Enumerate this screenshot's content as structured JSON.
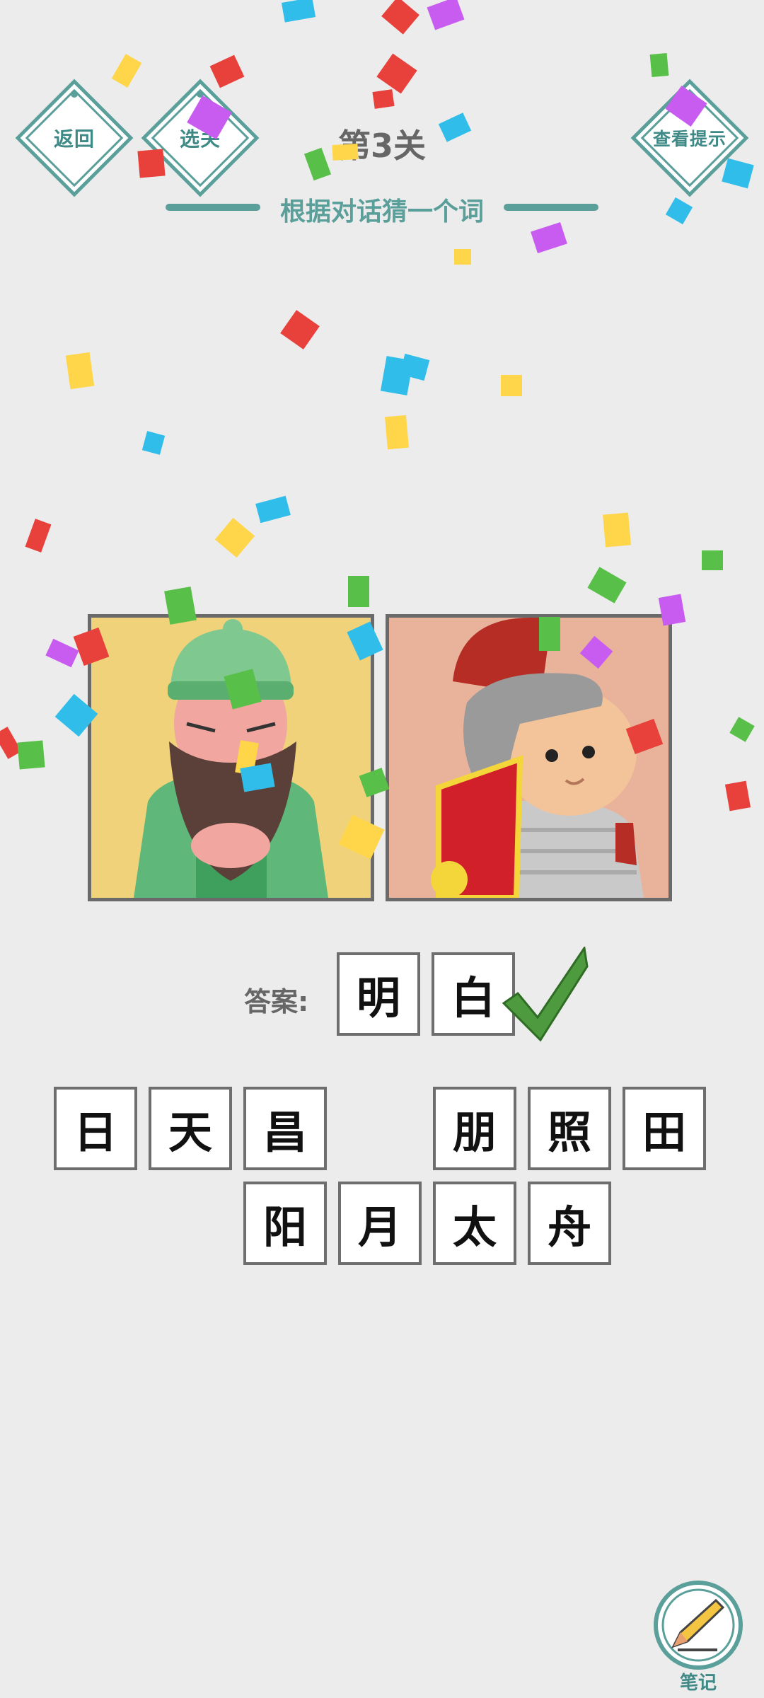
{
  "header": {
    "back_label": "返回",
    "select_level_label": "选关",
    "hint_label": "查看提示",
    "level_title": "第3关",
    "subtitle": "根据对话猜一个词"
  },
  "answer": {
    "label": "答案:",
    "chars": [
      "明",
      "白"
    ],
    "status": "correct"
  },
  "choices": {
    "row1": [
      "日",
      "天",
      "昌",
      "",
      "朋",
      "照",
      "田"
    ],
    "row2": [
      "阳",
      "月",
      "太",
      "舟"
    ]
  },
  "notes": {
    "label": "笔记"
  },
  "colors": {
    "accent": "#5b9f9a",
    "background": "#ececec",
    "check": "#4e9a3e",
    "confetti": [
      "#e8413c",
      "#ffd54a",
      "#31bdea",
      "#c85cf0",
      "#58c048"
    ]
  },
  "icons": {
    "correct": "checkmark-icon",
    "notes": "pencil-icon"
  }
}
